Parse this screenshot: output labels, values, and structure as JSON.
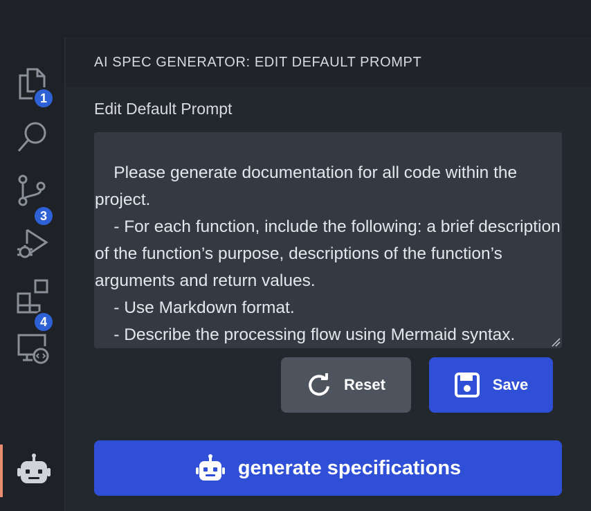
{
  "panel": {
    "title": "AI SPEC GENERATOR: EDIT DEFAULT PROMPT",
    "section_label": "Edit Default Prompt",
    "prompt_text": "Please generate documentation for all code within the project.\n    - For each function, include the following: a brief description of the function’s purpose, descriptions of the function’s arguments and return values.\n    - Use Markdown format.\n    - Describe the processing flow using Mermaid syntax."
  },
  "buttons": {
    "reset_label": "Reset",
    "save_label": "Save",
    "generate_label": "generate specifications"
  },
  "activity_bar": {
    "items": [
      {
        "icon": "files-icon",
        "badge": "1"
      },
      {
        "icon": "search-icon",
        "badge": ""
      },
      {
        "icon": "source-control-icon",
        "badge": "3"
      },
      {
        "icon": "run-debug-icon",
        "badge": ""
      },
      {
        "icon": "extensions-icon",
        "badge": "4"
      },
      {
        "icon": "remote-explorer-icon",
        "badge": ""
      },
      {
        "icon": "robot-icon",
        "badge": ""
      }
    ]
  },
  "colors": {
    "accent": "#2f4fd6",
    "badge": "#2f61d6",
    "active_indicator": "#e88b6e",
    "background": "#23272e"
  }
}
